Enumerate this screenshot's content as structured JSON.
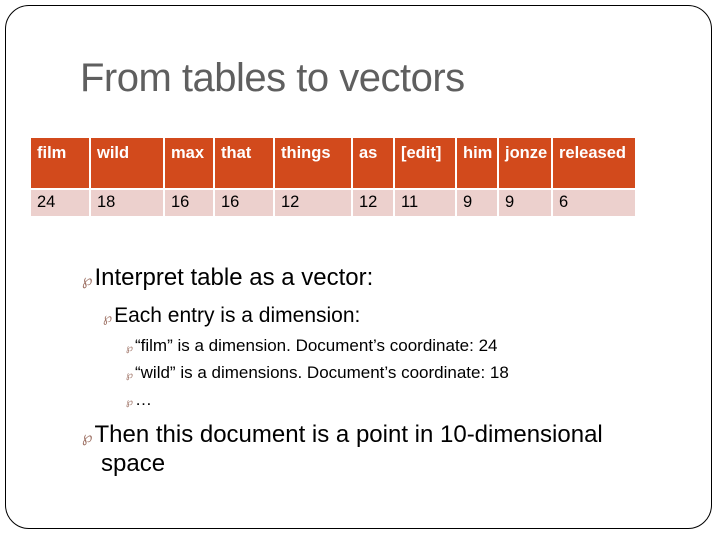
{
  "slide": {
    "title": "From tables to vectors",
    "table": {
      "header": [
        "film",
        "wild",
        "max",
        "that",
        "things",
        "as",
        "[edit]",
        "him",
        "jonze",
        "released"
      ],
      "values": [
        "24",
        "18",
        "16",
        "16",
        "12",
        "12",
        "11",
        "9",
        "9",
        "6"
      ],
      "header_color": "#d24a1c",
      "row_color": "#ecd0cd"
    },
    "bullet_icon": "ornament-curl-icon",
    "bullets": [
      {
        "level": 1,
        "text": "Interpret table as a vector:"
      },
      {
        "level": 2,
        "text": "Each entry is a dimension:"
      },
      {
        "level": 3,
        "text": "“film” is a dimension. Document’s coordinate: 24"
      },
      {
        "level": 3,
        "text": "“wild” is a dimensions. Document’s coordinate: 18"
      },
      {
        "level": 3,
        "text": "…"
      },
      {
        "level": 1,
        "text": "Then this document is a point in 10-dimensional",
        "continuation": "space"
      }
    ]
  }
}
